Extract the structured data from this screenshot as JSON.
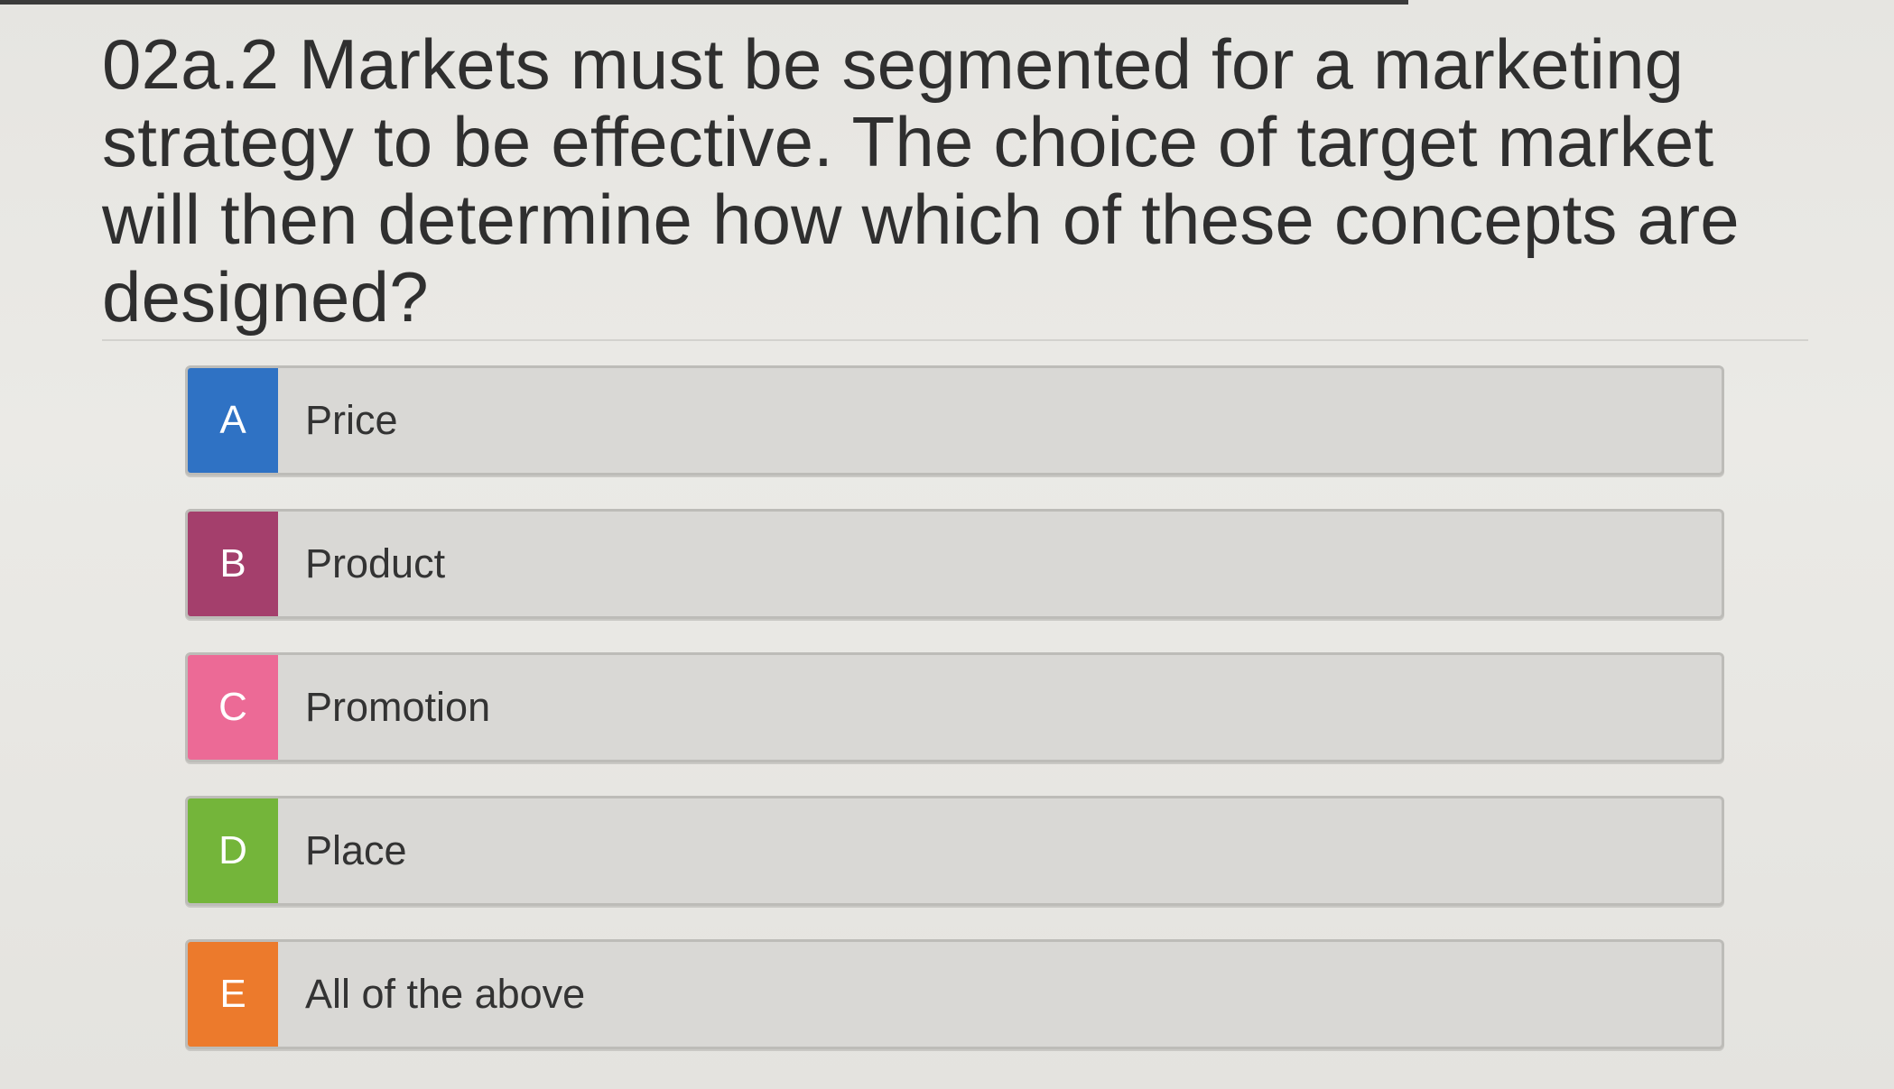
{
  "question": {
    "text": "02a.2 Markets must be segmented for a marketing strategy to be effective. The choice of target market will then determine how which of these concepts are designed?"
  },
  "options": [
    {
      "letter": "A",
      "label": "Price",
      "color": "#2f72c4"
    },
    {
      "letter": "B",
      "label": "Product",
      "color": "#a43f6c"
    },
    {
      "letter": "C",
      "label": "Promotion",
      "color": "#ec6a96"
    },
    {
      "letter": "D",
      "label": "Place",
      "color": "#74b53a"
    },
    {
      "letter": "E",
      "label": "All of the above",
      "color": "#ec7a2c"
    }
  ]
}
